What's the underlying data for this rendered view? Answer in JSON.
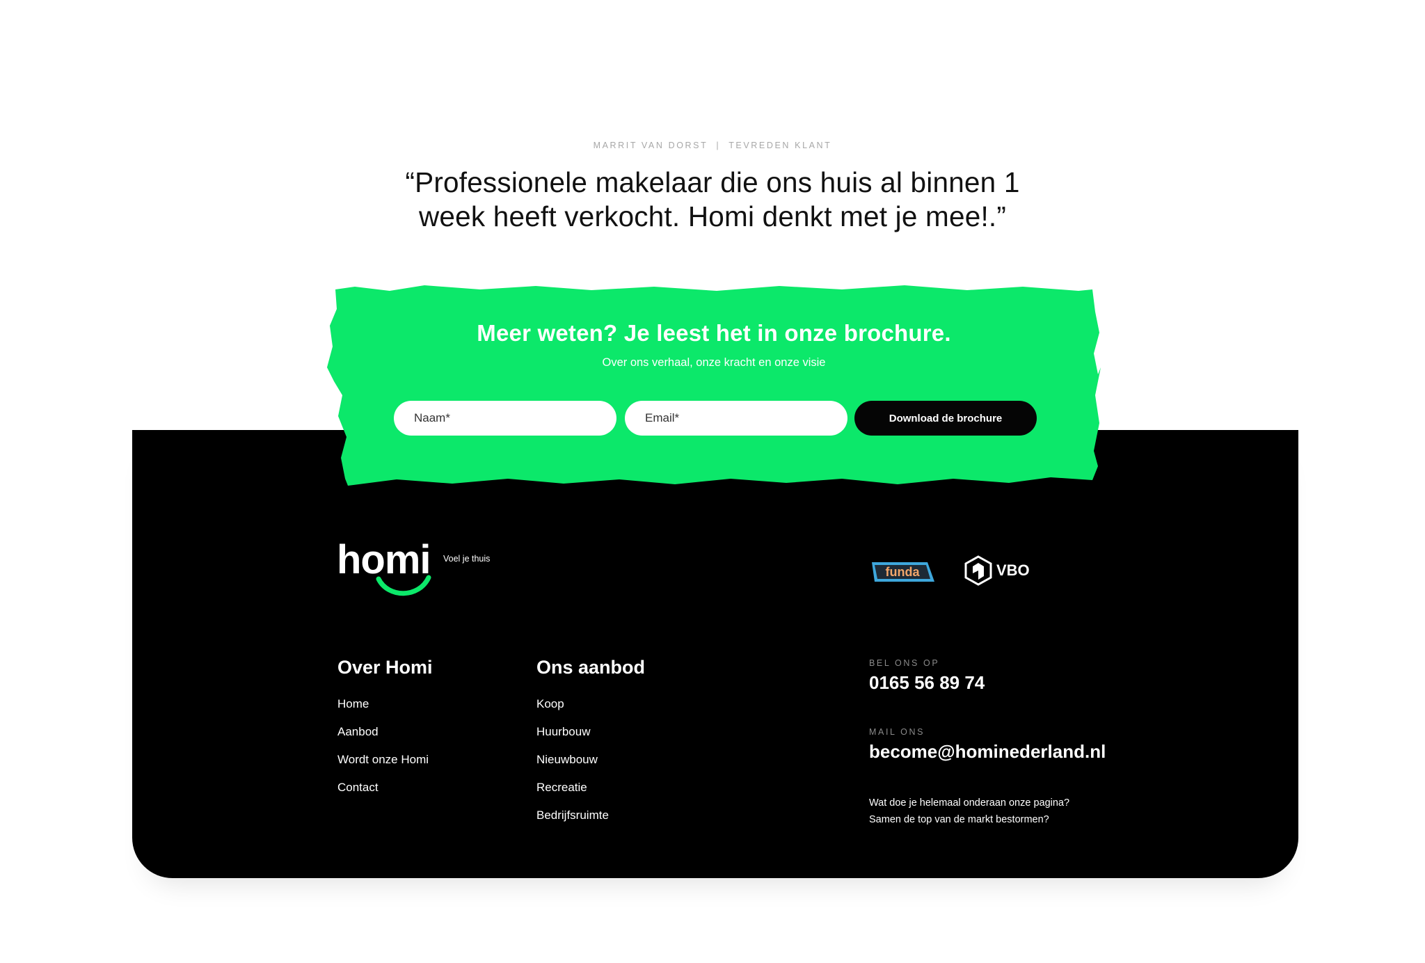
{
  "testimonial": {
    "author": "MARRIT VAN DORST",
    "separator": "|",
    "role": "TEVREDEN KLANT",
    "quote_line1": "“Professionele makelaar die ons huis al binnen 1",
    "quote_line2": "week heeft verkocht. Homi denkt met je mee!.”"
  },
  "brochure": {
    "title": "Meer weten? Je leest het in onze brochure.",
    "subtitle": "Over ons verhaal, onze kracht en onze visie",
    "name_placeholder": "Naam*",
    "email_placeholder": "Email*",
    "button_label": "Download de brochure",
    "accent_color": "#0ce86a"
  },
  "footer": {
    "logo": {
      "wordmark": "homi",
      "tagline": "Voel je thuis",
      "icon": "smile-icon"
    },
    "partners": [
      {
        "name": "funda",
        "icon": "funda-logo"
      },
      {
        "name": "VBO",
        "icon": "vbo-logo"
      }
    ],
    "columns": [
      {
        "title": "Over Homi",
        "links": [
          "Home",
          "Aanbod",
          "Wordt onze Homi",
          "Contact"
        ]
      },
      {
        "title": "Ons aanbod",
        "links": [
          "Koop",
          "Huurbouw",
          "Nieuwbouw",
          "Recreatie",
          "Bedrijfsruimte"
        ]
      }
    ],
    "contact": {
      "phone_label": "BEL ONS OP",
      "phone": "0165 56 89 74",
      "mail_label": "MAIL ONS",
      "email": "become@hominederland.nl",
      "note_line1": "Wat doe je helemaal onderaan onze pagina?",
      "note_line2": "Samen de top van de markt bestormen?"
    }
  }
}
